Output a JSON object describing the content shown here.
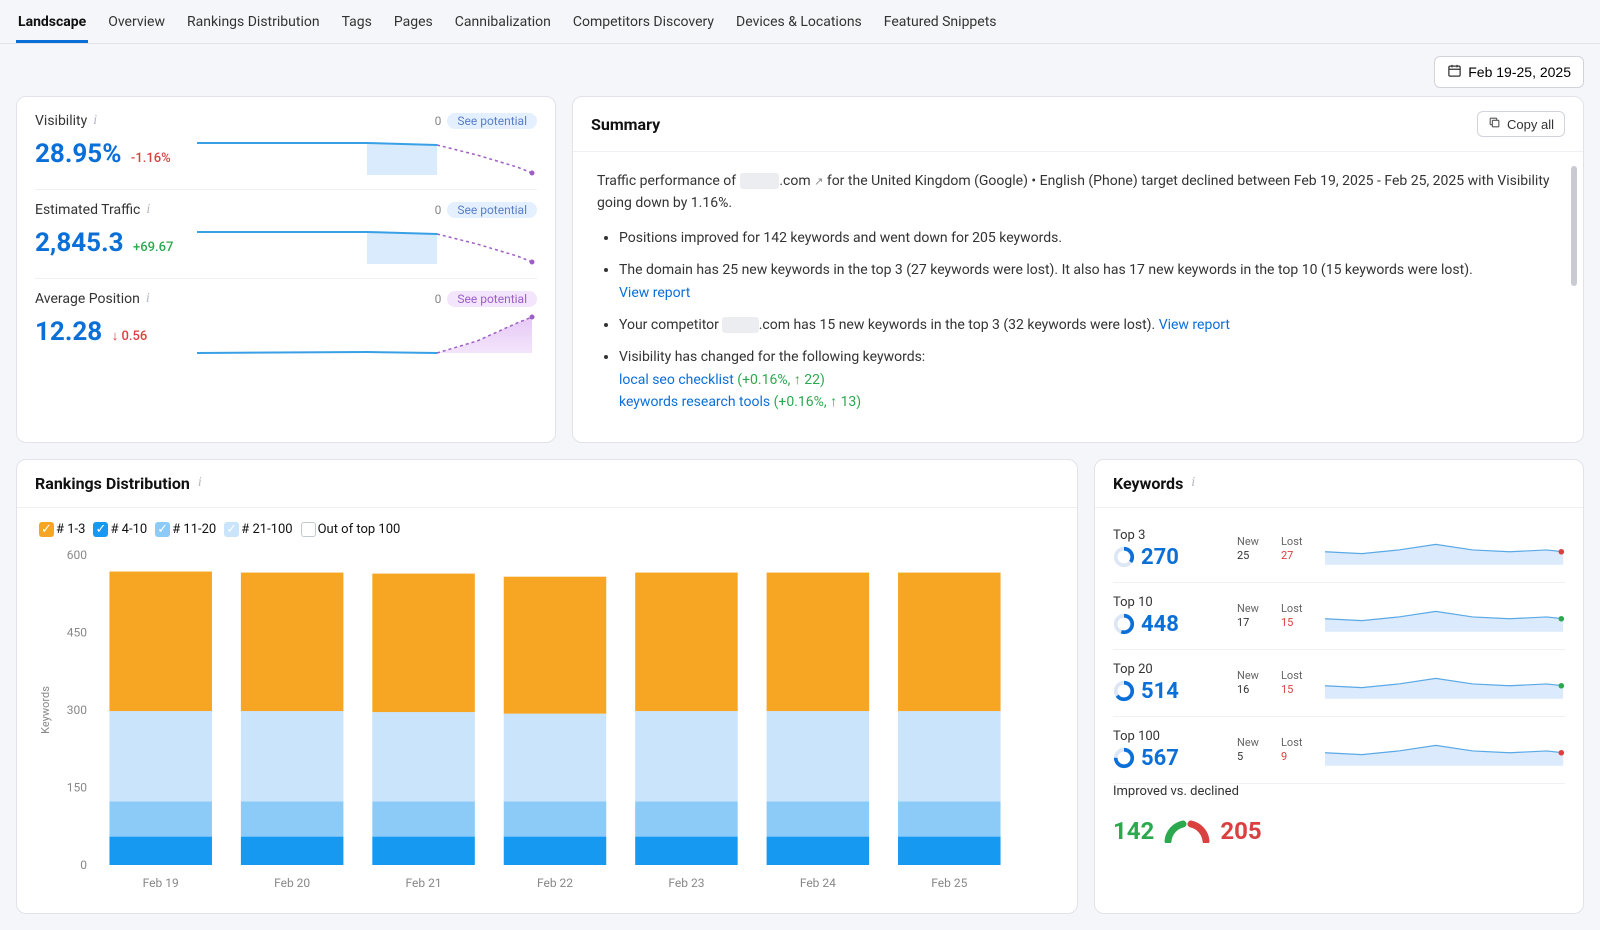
{
  "tabs": [
    "Landscape",
    "Overview",
    "Rankings Distribution",
    "Tags",
    "Pages",
    "Cannibalization",
    "Competitors Discovery",
    "Devices & Locations",
    "Featured Snippets"
  ],
  "activeTab": 0,
  "dateRange": "Feb 19-25, 2025",
  "metrics": {
    "visibility": {
      "label": "Visibility",
      "value": "28.95%",
      "delta": "-1.16%",
      "deltaSign": "neg",
      "zero": "0",
      "pill": "See potential",
      "pillStyle": "blue"
    },
    "traffic": {
      "label": "Estimated Traffic",
      "value": "2,845.3",
      "delta": "+69.67",
      "deltaSign": "pos",
      "zero": "0",
      "pill": "See potential",
      "pillStyle": "blue"
    },
    "avgpos": {
      "label": "Average Position",
      "value": "12.28",
      "delta": "0.56",
      "deltaSign": "neg",
      "arrow": "↓",
      "zero": "0",
      "pill": "See potential",
      "pillStyle": "purple"
    }
  },
  "summary": {
    "title": "Summary",
    "copy": "Copy all",
    "domainMasked": ".com",
    "intro1a": "Traffic performance of ",
    "intro1b": " for the United Kingdom (Google) • English (Phone) target declined between Feb 19, 2025 - Feb 25, 2025 with Visibility going down by 1.16%.",
    "b1": "Positions improved for 142 keywords and went down for 205 keywords.",
    "b2a": "The domain has 25 new keywords in the top 3 (27 keywords were lost). It also has 17 new keywords in the top 10 (15 keywords were lost). ",
    "b2link": "View report",
    "b3a": "Your competitor ",
    "b3b": ".com has 15 new keywords in the top 3 (32 keywords were lost). ",
    "b3link": "View report",
    "b4a": "Visibility has changed for the following keywords:",
    "b4_k1_text": "local seo checklist",
    "b4_k1_chg": " (+0.16%, ↑ 22)",
    "b4_k2_text": "keywords research tools",
    "b4_k2_chg": " (+0.16%, ↑ 13)"
  },
  "rank_dist": {
    "title": "Rankings Distribution",
    "legend": [
      "# 1-3",
      "# 4-10",
      "# 11-20",
      "# 21-100",
      "Out of top 100"
    ],
    "chart_data": {
      "type": "bar",
      "stacked": true,
      "categories": [
        "Feb 19",
        "Feb 20",
        "Feb 21",
        "Feb 22",
        "Feb 23",
        "Feb 24",
        "Feb 25"
      ],
      "series": [
        {
          "name": "# 1-3",
          "color": "#169af1",
          "values": [
            55,
            55,
            55,
            55,
            55,
            55,
            55
          ]
        },
        {
          "name": "# 4-10",
          "color": "#8ccbf7",
          "values": [
            68,
            68,
            68,
            68,
            68,
            68,
            68
          ]
        },
        {
          "name": "# 11-20",
          "color": "#c9e4fb",
          "values": [
            175,
            175,
            173,
            170,
            175,
            175,
            175
          ]
        },
        {
          "name": "# 21-100",
          "color": "#f6a623",
          "values": [
            270,
            268,
            268,
            265,
            268,
            268,
            268
          ]
        }
      ],
      "ylabel": "Keywords",
      "yticks": [
        0,
        150,
        300,
        450,
        600
      ],
      "ylim": [
        0,
        600
      ]
    }
  },
  "keywords": {
    "title": "Keywords",
    "rows": [
      {
        "label": "Top 3",
        "value": "270",
        "new": "25",
        "lost": "27",
        "donutPct": 0.35,
        "dot": "#d9403f"
      },
      {
        "label": "Top 10",
        "value": "448",
        "new": "17",
        "lost": "15",
        "donutPct": 0.55,
        "dot": "#2ca94f"
      },
      {
        "label": "Top 20",
        "value": "514",
        "new": "16",
        "lost": "15",
        "donutPct": 0.65,
        "dot": "#2ca94f"
      },
      {
        "label": "Top 100",
        "value": "567",
        "new": "5",
        "lost": "9",
        "donutPct": 0.75,
        "dot": "#d9403f"
      }
    ],
    "ivd": {
      "label": "Improved vs. declined",
      "improved": "142",
      "declined": "205"
    }
  },
  "labels": {
    "new": "New",
    "lost": "Lost"
  }
}
